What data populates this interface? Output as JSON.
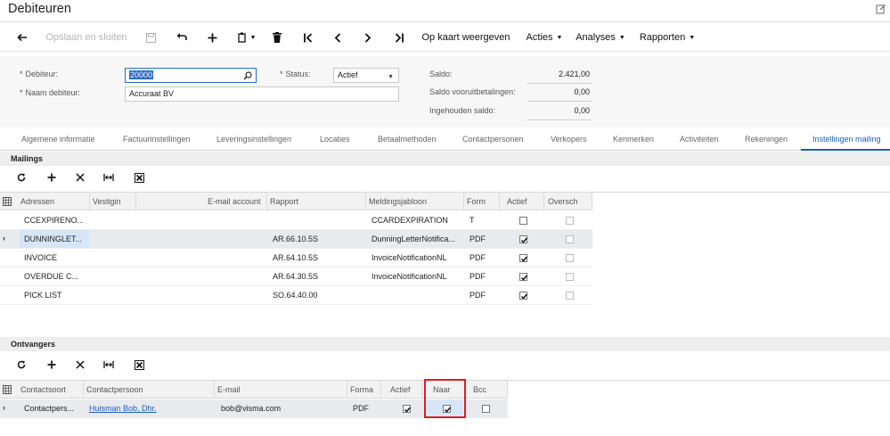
{
  "header": {
    "title": "Debiteuren"
  },
  "toolbar": {
    "save_close": "Opslaan en sluiten",
    "map": "Op kaart weergeven",
    "actions": "Acties",
    "analyses": "Analyses",
    "reports": "Rapporten"
  },
  "form": {
    "customer_label": "Debiteur:",
    "customer_value": "20000",
    "name_label": "Naam debiteur:",
    "name_value": "Accuraat BV",
    "status_label": "Status:",
    "status_value": "Actief",
    "balance_label": "Saldo:",
    "balance_value": "2.421,00",
    "prepay_label": "Saldo vooruitbetalingen:",
    "prepay_value": "0,00",
    "retained_label": "Ingehouden saldo:",
    "retained_value": "0,00"
  },
  "tabs": [
    "Algemene informatie",
    "Factuurinstellingen",
    "Leveringsinstellingen",
    "Locaties",
    "Betaalmethoden",
    "Contactpersonen",
    "Verkopers",
    "Kenmerken",
    "Activiteiten",
    "Rekeningen",
    "Instellingen mailing"
  ],
  "mailings": {
    "title": "Mailings",
    "columns": [
      "Adressen",
      "Vestigin",
      "E-mail account",
      "Rapport",
      "Meldingsjabloon",
      "Form",
      "Actief",
      "Oversch"
    ],
    "rows": [
      {
        "address": "CCEXPIRENO...",
        "report": "",
        "template": "CCARDEXPIRATION",
        "format": "T",
        "active": false,
        "override": false
      },
      {
        "address": "DUNNINGLET...",
        "report": "AR.66.10.5S",
        "template": "DunningLetterNotifica...",
        "format": "PDF",
        "active": true,
        "override": false
      },
      {
        "address": "INVOICE",
        "report": "AR.64.10.5S",
        "template": "InvoiceNotificationNL",
        "format": "PDF",
        "active": true,
        "override": false
      },
      {
        "address": "OVERDUE C...",
        "report": "AR.64.30.5S",
        "template": "InvoiceNotificationNL",
        "format": "PDF",
        "active": true,
        "override": false
      },
      {
        "address": "PICK LIST",
        "report": "SO.64.40.00",
        "template": "",
        "format": "PDF",
        "active": true,
        "override": false
      }
    ]
  },
  "recipients": {
    "title": "Ontvangers",
    "columns": [
      "Contactsoort",
      "Contactpersoon",
      "E-mail",
      "Forma",
      "Actief",
      "Naar",
      "Bcc"
    ],
    "rows": [
      {
        "type": "Contactpers...",
        "person": "Huisman Bob, Dhr.",
        "email": "bob@visma.com",
        "format": "PDF",
        "active": true,
        "to": true,
        "bcc": false
      }
    ]
  },
  "colors": {
    "accent": "#1a5fb4",
    "highlight": "#e01b24"
  }
}
